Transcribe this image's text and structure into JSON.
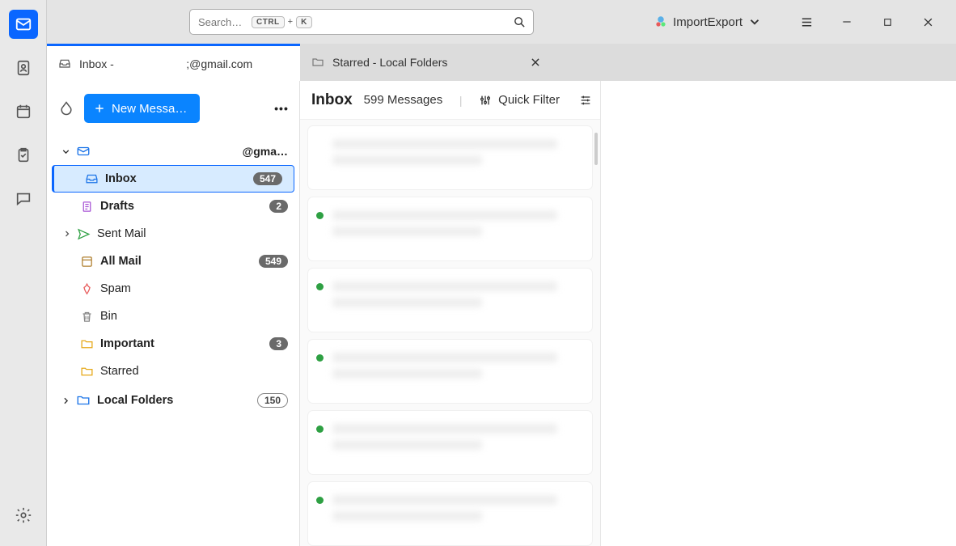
{
  "search": {
    "placeholder": "Search…",
    "kbd1": "CTRL",
    "kbd2": "K",
    "kbdPlus": "+"
  },
  "titlebar": {
    "importExport": "ImportExport"
  },
  "tabs": [
    {
      "label": "Inbox -                       ;@gmail.com",
      "active": true
    },
    {
      "label": "Starred - Local Folders",
      "active": false
    }
  ],
  "sidebar": {
    "newMessage": "New Messa…",
    "accountLabel": "@gma…",
    "items": [
      {
        "name": "Inbox",
        "label": "Inbox",
        "count": "547",
        "bold": true,
        "selected": true,
        "icon": "inbox"
      },
      {
        "name": "Drafts",
        "label": "Drafts",
        "count": "2",
        "bold": true,
        "icon": "drafts"
      },
      {
        "name": "Sent",
        "label": "Sent Mail",
        "icon": "sent",
        "expandable": true
      },
      {
        "name": "AllMail",
        "label": "All Mail",
        "count": "549",
        "bold": true,
        "icon": "allmail"
      },
      {
        "name": "Spam",
        "label": "Spam",
        "icon": "spam"
      },
      {
        "name": "Bin",
        "label": "Bin",
        "icon": "bin"
      },
      {
        "name": "Important",
        "label": "Important",
        "count": "3",
        "bold": true,
        "icon": "folder-yellow"
      },
      {
        "name": "Starred",
        "label": "Starred",
        "icon": "folder-yellow"
      }
    ],
    "localFolders": {
      "label": "Local Folders",
      "count": "150",
      "bold": true
    }
  },
  "msglist": {
    "folder": "Inbox",
    "countText": "599 Messages",
    "quickFilter": "Quick Filter",
    "messages": [
      {
        "dot": false
      },
      {
        "dot": true
      },
      {
        "dot": true
      },
      {
        "dot": true
      },
      {
        "dot": true
      },
      {
        "dot": true
      }
    ]
  }
}
